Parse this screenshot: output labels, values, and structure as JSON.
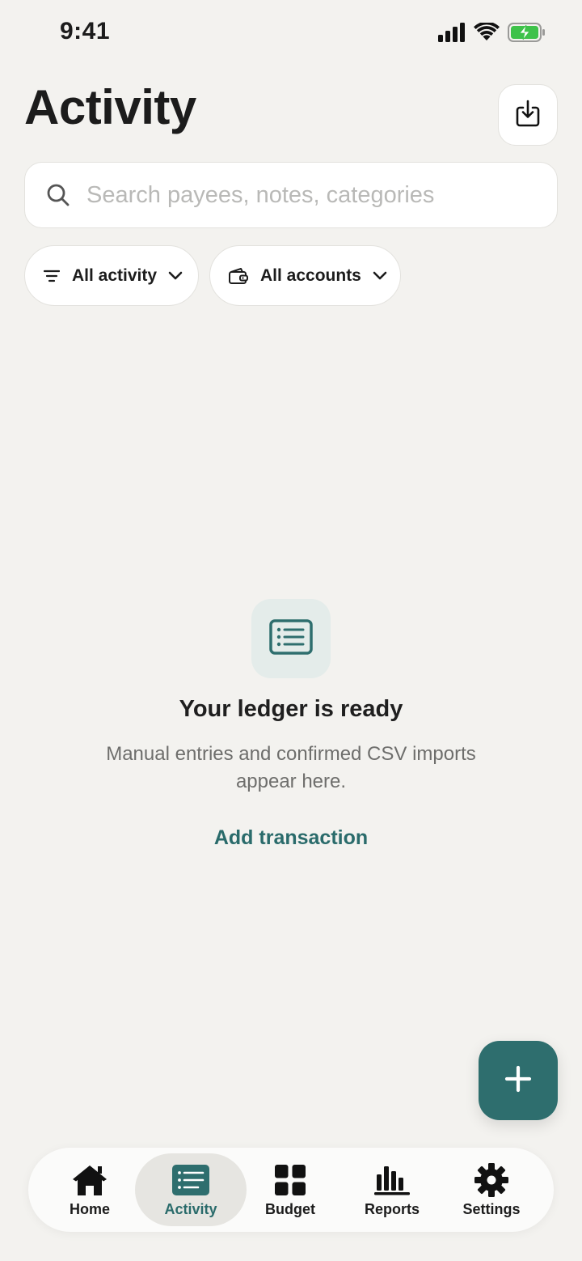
{
  "status_bar": {
    "time": "9:41"
  },
  "header": {
    "title": "Activity"
  },
  "search": {
    "placeholder": "Search payees, notes, categories"
  },
  "filters": {
    "activity_label": "All activity",
    "accounts_label": "All accounts"
  },
  "empty_state": {
    "title": "Your ledger is ready",
    "description": "Manual entries and confirmed CSV imports appear here.",
    "action_label": "Add transaction"
  },
  "tab_bar": {
    "items": [
      {
        "label": "Home",
        "icon": "home-icon"
      },
      {
        "label": "Activity",
        "icon": "activity-list-icon",
        "active": true
      },
      {
        "label": "Budget",
        "icon": "budget-grid-icon"
      },
      {
        "label": "Reports",
        "icon": "reports-bar-icon"
      },
      {
        "label": "Settings",
        "icon": "gear-icon"
      }
    ]
  },
  "colors": {
    "background": "#f3f2ef",
    "accent": "#2e6e6e",
    "accent_text": "#2a6b6b",
    "battery_green": "#3ec24a"
  }
}
